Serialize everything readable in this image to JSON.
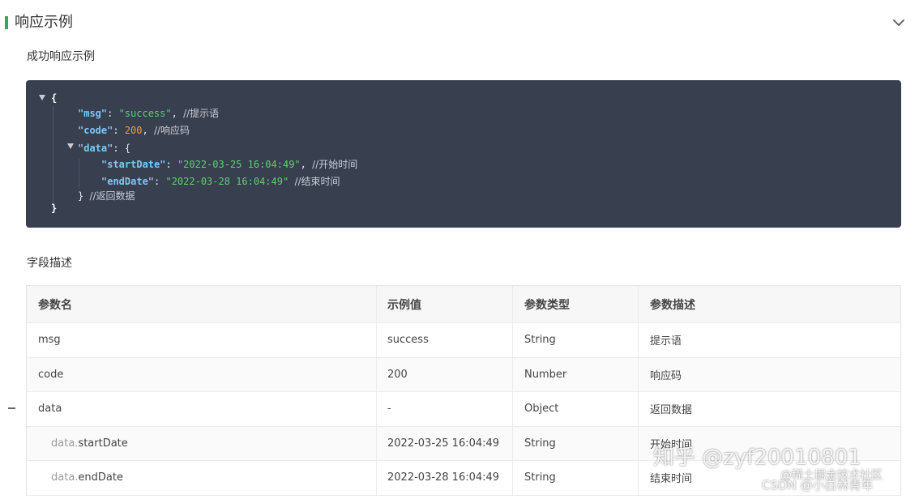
{
  "section": {
    "title": "响应示例"
  },
  "success_example": {
    "title": "成功响应示例",
    "lines": {
      "open_brace": "{",
      "msg_key": "\"msg\"",
      "msg_val": "\"success\"",
      "msg_comment": "//提示语",
      "code_key": "\"code\"",
      "code_val": "200",
      "code_comment": "//响应码",
      "data_key": "\"data\"",
      "data_open": "{",
      "start_key": "\"startDate\"",
      "start_val": "\"2022-03-25 16:04:49\"",
      "start_comment": "//开始时间",
      "end_key": "\"endDate\"",
      "end_val": "\"2022-03-28 16:04:49\"",
      "end_comment": "//结束时间",
      "data_close": "}",
      "data_comment": "//返回数据",
      "close_brace": "}"
    }
  },
  "fields": {
    "title": "字段描述",
    "columns": [
      "参数名",
      "示例值",
      "参数类型",
      "参数描述"
    ],
    "rows": [
      {
        "prefix": "",
        "name": "msg",
        "example": "success",
        "type": "String",
        "desc": "提示语"
      },
      {
        "prefix": "",
        "name": "code",
        "example": "200",
        "type": "Number",
        "desc": "响应码"
      },
      {
        "prefix": "",
        "name": "data",
        "example": "-",
        "type": "Object",
        "desc": "返回数据"
      },
      {
        "prefix": "data.",
        "name": "startDate",
        "example": "2022-03-25 16:04:49",
        "type": "String",
        "desc": "开始时间"
      },
      {
        "prefix": "data.",
        "name": "endDate",
        "example": "2022-03-28 16:04:49",
        "type": "String",
        "desc": "结束时间"
      }
    ]
  },
  "watermark": {
    "zhihu": "知乎 @zyf20010801",
    "juejin": "@稀土掘金技术社区",
    "csdn": "CSDN @小白林青年"
  },
  "icons": {
    "collapse": "chevron-down-icon",
    "tree_toggle": "caret-down-icon",
    "row_toggle": "minus-icon"
  },
  "colors": {
    "accent": "#2bab5a",
    "code_bg": "#383f4f",
    "json_key": "#7ec8f6",
    "json_string": "#5fd06f",
    "json_number": "#f39a3c"
  }
}
